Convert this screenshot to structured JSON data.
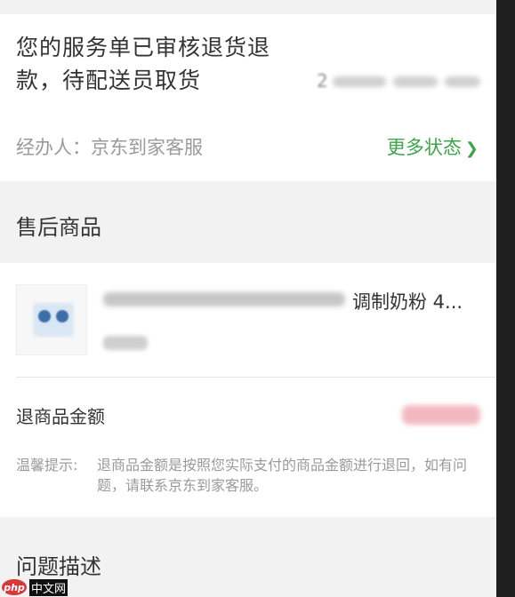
{
  "status": {
    "title": "您的服务单已审核退货退款，待配送员取货",
    "date_visible": "2",
    "handler": "经办人：京东到家客服",
    "more_label": "更多状态"
  },
  "after_sales": {
    "section_title": "售后商品",
    "product": {
      "name_visible": "调制奶粉 4..."
    },
    "refund_label": "退商品金额",
    "tip_label": "温馨提示:",
    "tip_text": "退商品金额是按照您实际支付的商品金额进行退回，如有问题，请联系京东到家客服。"
  },
  "problem": {
    "section_title": "问题描述"
  },
  "watermark": {
    "logo": "php",
    "site": "中文网"
  },
  "colors": {
    "green_accent": "#3fa34d",
    "refund_blur": "#f2b8c1"
  }
}
